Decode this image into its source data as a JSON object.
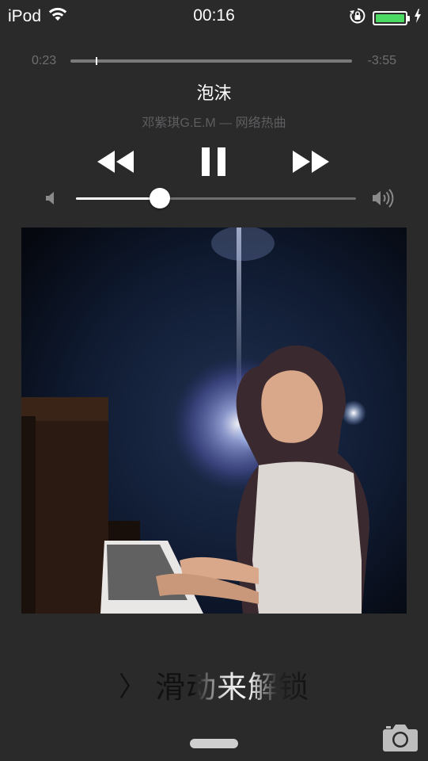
{
  "status_bar": {
    "device": "iPod",
    "time": "00:16",
    "battery_level": 1.0,
    "battery_color": "#4cd964",
    "icons": [
      "wifi-icon",
      "rotation-lock-icon",
      "battery-icon",
      "charging-bolt-icon"
    ]
  },
  "now_playing": {
    "elapsed": "0:23",
    "remaining": "-3:55",
    "progress_fraction": 0.09,
    "song_title": "泡沫",
    "artist_album": "邓紫琪G.E.M — 网络热曲",
    "volume_fraction": 0.3,
    "controls": [
      "rewind-icon",
      "pause-icon",
      "fast-forward-icon"
    ]
  },
  "lock": {
    "chevron": "〉",
    "slide_text": "滑动来解锁",
    "camera_icon": "camera-icon"
  },
  "colors": {
    "background": "#2a2a2b",
    "muted_text": "#6f6f70",
    "battery": "#4cd964"
  }
}
